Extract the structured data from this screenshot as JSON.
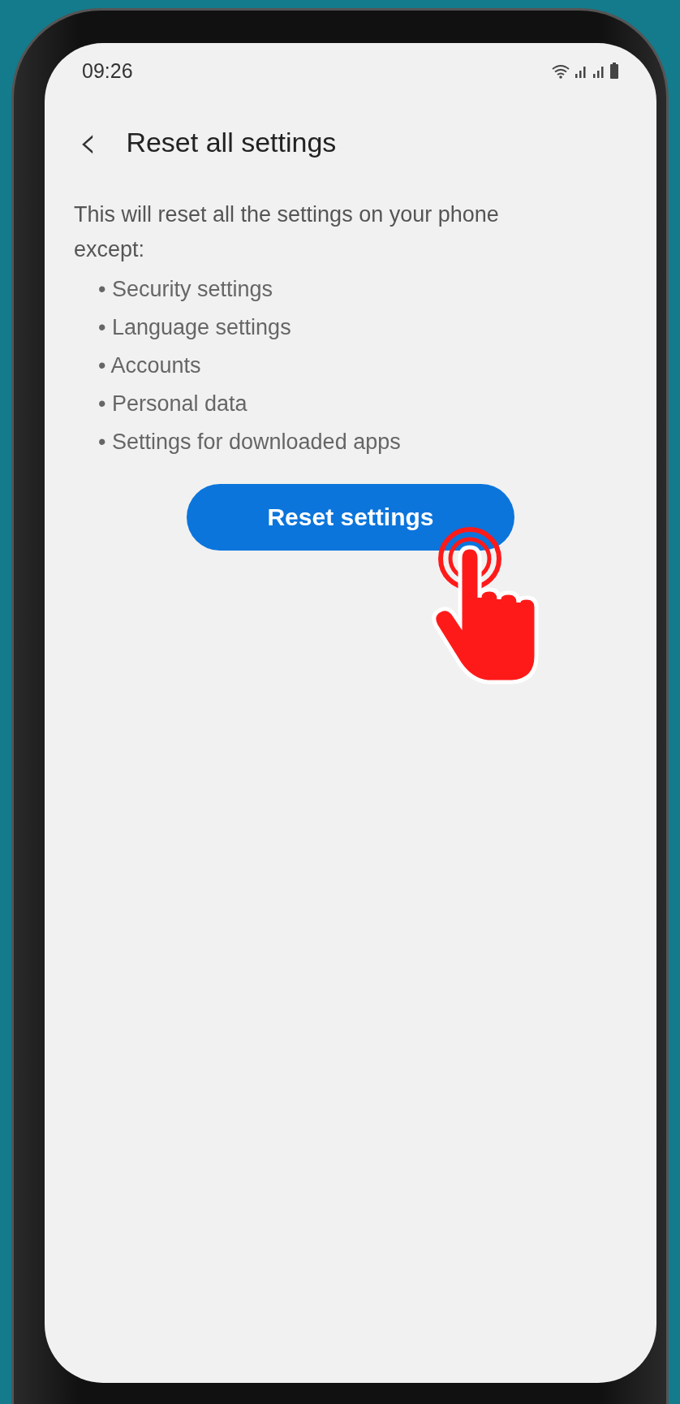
{
  "status_bar": {
    "time": "09:26"
  },
  "header": {
    "back": "‹",
    "title": "Reset all settings"
  },
  "description": "This will reset all the settings on your phone except:",
  "exceptions": [
    "• Security settings",
    "• Language settings",
    "• Accounts",
    "• Personal data",
    "• Settings for downloaded apps"
  ],
  "button": {
    "label": "Reset settings"
  }
}
